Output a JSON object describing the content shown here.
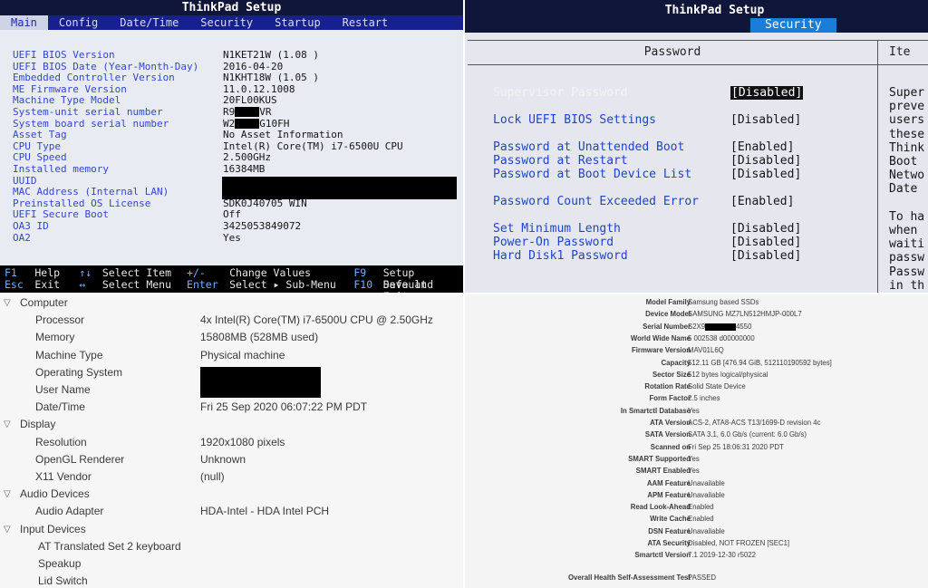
{
  "bios_main": {
    "title": "ThinkPad Setup",
    "tabs": [
      "Main",
      "Config",
      "Date/Time",
      "Security",
      "Startup",
      "Restart"
    ],
    "rows": [
      {
        "label": "UEFI BIOS Version",
        "value": "N1KET21W (1.08 )"
      },
      {
        "label": "UEFI BIOS Date (Year-Month-Day)",
        "value": "2016-04-20"
      },
      {
        "label": "Embedded Controller Version",
        "value": "N1KHT18W (1.05 )"
      },
      {
        "label": "ME Firmware Version",
        "value": "11.0.12.1008"
      },
      {
        "label": "Machine Type Model",
        "value": "20FL00KUS"
      },
      {
        "label": "System-unit serial number",
        "value_prefix": "R9",
        "value_suffix": "VR"
      },
      {
        "label": "System board serial number",
        "value_prefix": "W2",
        "value_suffix": "G10FH"
      },
      {
        "label": "Asset Tag",
        "value": "No Asset Information"
      },
      {
        "label": "CPU Type",
        "value": "Intel(R) Core(TM) i7-6500U CPU"
      },
      {
        "label": "CPU Speed",
        "value": "2.500GHz"
      },
      {
        "label": "Installed memory",
        "value": "16384MB"
      },
      {
        "label": "UUID",
        "value": ""
      },
      {
        "label": "MAC Address (Internal LAN)",
        "value": ""
      },
      {
        "label": "Preinstalled OS License",
        "value": "SDK0J40705 WIN"
      },
      {
        "label": "UEFI Secure Boot",
        "value": "Off"
      },
      {
        "label": "OA3 ID",
        "value": "3425053849072"
      },
      {
        "label": "OA2",
        "value": "Yes"
      }
    ],
    "footer": {
      "line1": {
        "k1": "F1",
        "d1": "Help",
        "k2": "↑↓",
        "d2": "Select Item",
        "k3": "+/-",
        "d3": "Change Values",
        "k4": "F9",
        "d4": "Setup Default"
      },
      "line2": {
        "k1": "Esc",
        "d1": "Exit",
        "k2": "↔",
        "d2": "Select Menu",
        "k3": "Enter",
        "d3": "Select ▸ Sub-Menu",
        "k4": "F10",
        "d4": "Save and Exit"
      }
    },
    "colors": {
      "title_bg": "#10153a",
      "tab_bg": "#16208e",
      "label": "#3447c8"
    }
  },
  "bios_security": {
    "title": "ThinkPad Setup",
    "active_tab": "Security",
    "column_header": "Password",
    "help_header": "Ite",
    "items": [
      {
        "label": "Supervisor Password",
        "value": "[Disabled]",
        "selected": true
      },
      {
        "label": "Lock UEFI BIOS Settings",
        "value": "[Disabled]"
      },
      {
        "label": "Password at Unattended Boot",
        "value": "[Enabled]"
      },
      {
        "label": "Password at Restart",
        "value": "[Disabled]"
      },
      {
        "label": "Password at Boot Device List",
        "value": "[Disabled]"
      },
      {
        "label": "Password Count Exceeded Error",
        "value": "[Enabled]"
      },
      {
        "label": "Set Minimum Length",
        "value": "[Disabled]"
      },
      {
        "label": "Power-On Password",
        "value": "[Disabled]"
      },
      {
        "label": "Hard Disk1 Password",
        "value": "[Disabled]"
      }
    ],
    "help_text": "Super\npreve\nusers\nthese\nThink\nBoot\nNetwo\nDate\n\nTo ha\nwhen\nwaiti\npassw\nPassw\nin th"
  },
  "system_info": {
    "rows": [
      {
        "type": "cat",
        "label": "Computer"
      },
      {
        "type": "kv",
        "label": "Processor",
        "value": "4x Intel(R) Core(TM) i7-6500U CPU @ 2.50GHz"
      },
      {
        "type": "kv",
        "label": "Memory",
        "value": "15808MB (528MB used)"
      },
      {
        "type": "kv",
        "label": "Machine Type",
        "value": "Physical machine"
      },
      {
        "type": "kv",
        "label": "Operating System",
        "value": ""
      },
      {
        "type": "kv",
        "label": "User Name",
        "value": ""
      },
      {
        "type": "kv",
        "label": "Date/Time",
        "value": "Fri 25 Sep 2020 06:07:22 PM PDT"
      },
      {
        "type": "cat",
        "label": "Display"
      },
      {
        "type": "kv",
        "label": "Resolution",
        "value": "1920x1080 pixels"
      },
      {
        "type": "kv",
        "label": "OpenGL Renderer",
        "value": "Unknown"
      },
      {
        "type": "kv",
        "label": "X11 Vendor",
        "value": "(null)"
      },
      {
        "type": "cat",
        "label": "Audio Devices"
      },
      {
        "type": "kv",
        "label": "Audio Adapter",
        "value": "HDA-Intel - HDA Intel PCH"
      },
      {
        "type": "cat",
        "label": "Input Devices"
      },
      {
        "type": "kv2",
        "label": "AT Translated Set 2 keyboard",
        "value": ""
      },
      {
        "type": "kv2",
        "label": "Speakup",
        "value": ""
      },
      {
        "type": "kv2",
        "label": "Lid Switch",
        "value": ""
      }
    ]
  },
  "smart_info": {
    "rows": [
      {
        "label": "Model Family",
        "value": "Samsung based SSDs"
      },
      {
        "label": "Device Model",
        "value": "SAMSUNG MZ7LN512HMJP-000L7"
      },
      {
        "label": "Serial Number",
        "value_prefix": "S2X9",
        "value_suffix": "4550"
      },
      {
        "label": "World Wide Name",
        "value": "5 002538 d00000000"
      },
      {
        "label": "Firmware Version",
        "value": "MAV01L6Q"
      },
      {
        "label": "Capacity",
        "value": "512.11 GB [476.94 GiB, 512110190592 bytes]"
      },
      {
        "label": "Sector Size",
        "value": "512 bytes logical/physical"
      },
      {
        "label": "Rotation Rate",
        "value": "Solid State Device"
      },
      {
        "label": "Form Factor",
        "value": "2.5 inches"
      },
      {
        "label": "In Smartctl Database",
        "value": "Yes"
      },
      {
        "label": "ATA Version",
        "value": "ACS-2, ATA8-ACS T13/1699-D revision 4c"
      },
      {
        "label": "SATA Version",
        "value": "SATA 3.1, 6.0 Gb/s (current: 6.0 Gb/s)"
      },
      {
        "label": "Scanned on",
        "value": "Fri Sep 25 18:06:31 2020 PDT"
      },
      {
        "label": "SMART Supported",
        "value": "Yes"
      },
      {
        "label": "SMART Enabled",
        "value": "Yes"
      },
      {
        "label": "AAM Feature",
        "value": "Unavailable"
      },
      {
        "label": "APM Feature",
        "value": "Unavailable"
      },
      {
        "label": "Read Look-Ahead",
        "value": "Enabled"
      },
      {
        "label": "Write Cache",
        "value": "Enabled"
      },
      {
        "label": "DSN Feature",
        "value": "Unavailable"
      },
      {
        "label": "ATA Security",
        "value": "Disabled, NOT FROZEN [SEC1]"
      },
      {
        "label": "Smartctl Version",
        "value": "7.1 2019-12-30 r5022"
      }
    ],
    "health": {
      "label": "Overall Health Self-Assessment Test",
      "value": "PASSED"
    }
  }
}
